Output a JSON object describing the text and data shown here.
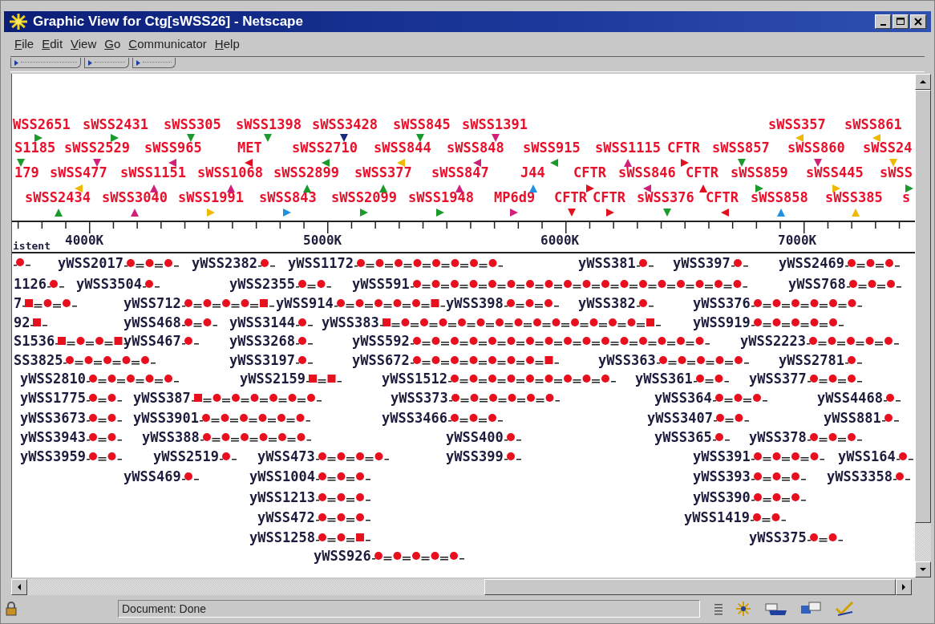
{
  "window": {
    "title": "Graphic View for Ctg[sWSS26] - Netscape"
  },
  "menu": [
    "File",
    "Edit",
    "View",
    "Go",
    "Communicator",
    "Help"
  ],
  "map": {
    "label_rows": [
      [
        "WSS2651",
        "sWSS2431",
        "sWSS305",
        "sWSS1398",
        "sWSS3428",
        "sWSS845",
        "sWSS1391",
        "sWSS357",
        "sWSS861"
      ],
      [
        "S1185",
        "sWSS2529",
        "sWSS965",
        "MET",
        "sWSS2710",
        "sWSS844",
        "sWSS848",
        "sWSS915",
        "sWSS1115",
        "CFTR",
        "sWSS857",
        "sWSS860",
        "sWSS24"
      ],
      [
        "179",
        "sWSS477",
        "sWSS1151",
        "sWSS1068",
        "sWSS2899",
        "sWSS377",
        "sWSS847",
        "J44",
        "CFTR",
        "sWSS846",
        "CFTR",
        "sWSS859",
        "sWSS445",
        "sWSS"
      ],
      [
        "sWSS2434",
        "sWSS3040",
        "sWSS1991",
        "sWSS843",
        "sWSS2099",
        "sWSS1948",
        "MP6d9",
        "CFTR",
        "CFTR",
        "sWSS376",
        "CFTR",
        "sWSS858",
        "sWSS385",
        "s"
      ]
    ],
    "triangle_rows": [
      [
        {
          "color": "#1a9a2a",
          "kind": "right"
        },
        {
          "color": "#1a9a2a",
          "kind": "right"
        },
        {
          "color": "#1a9a2a",
          "kind": "down"
        },
        {
          "color": "#1a9a2a",
          "kind": "down"
        },
        {
          "color": "#1a2a80",
          "kind": "down"
        },
        {
          "color": "#1a9a2a",
          "kind": "down"
        },
        {
          "color": "#d0207a",
          "kind": "down"
        },
        {
          "color": "#f0b800",
          "kind": "left"
        },
        {
          "color": "#f0b800",
          "kind": "left"
        }
      ],
      [
        {
          "color": "#1a9a2a",
          "kind": "down"
        },
        {
          "color": "#d0207a",
          "kind": "down"
        },
        {
          "color": "#d0207a",
          "kind": "left"
        },
        {
          "color": "#e01020",
          "kind": "left"
        },
        {
          "color": "#1a9a2a",
          "kind": "left"
        },
        {
          "color": "#f0b800",
          "kind": "left"
        },
        {
          "color": "#d0207a",
          "kind": "left"
        },
        {
          "color": "#1a9a2a",
          "kind": "left"
        },
        {
          "color": "#d0207a",
          "kind": "up"
        },
        {
          "color": "#e01020",
          "kind": "right"
        },
        {
          "color": "#1a9a2a",
          "kind": "down"
        },
        {
          "color": "#d0207a",
          "kind": "down"
        },
        {
          "color": "#f0b800",
          "kind": "down"
        }
      ],
      [
        {
          "color": "#f0b800",
          "kind": "left"
        },
        {
          "color": "#d0207a",
          "kind": "up"
        },
        {
          "color": "#d0207a",
          "kind": "up"
        },
        {
          "color": "#1a9a2a",
          "kind": "up"
        },
        {
          "color": "#1a9a2a",
          "kind": "up"
        },
        {
          "color": "#d0207a",
          "kind": "up"
        },
        {
          "color": "#2090e0",
          "kind": "up"
        },
        {
          "color": "#e01020",
          "kind": "right"
        },
        {
          "color": "#d0207a",
          "kind": "left"
        },
        {
          "color": "#e01020",
          "kind": "up"
        },
        {
          "color": "#1a9a2a",
          "kind": "right"
        },
        {
          "color": "#f0b800",
          "kind": "right"
        },
        {
          "color": "#1a9a2a",
          "kind": "right"
        }
      ],
      [
        {
          "color": "#1a9a2a",
          "kind": "up"
        },
        {
          "color": "#d0207a",
          "kind": "up"
        },
        {
          "color": "#f0b800",
          "kind": "right"
        },
        {
          "color": "#2090e0",
          "kind": "right"
        },
        {
          "color": "#1a9a2a",
          "kind": "right"
        },
        {
          "color": "#1a9a2a",
          "kind": "right"
        },
        {
          "color": "#d0207a",
          "kind": "right"
        },
        {
          "color": "#e01020",
          "kind": "down"
        },
        {
          "color": "#e01020",
          "kind": "right"
        },
        {
          "color": "#1a9a2a",
          "kind": "down"
        },
        {
          "color": "#e01020",
          "kind": "left"
        },
        {
          "color": "#2090e0",
          "kind": "up"
        },
        {
          "color": "#f0b800",
          "kind": "up"
        }
      ]
    ],
    "axis_labels": [
      "4000K",
      "5000K",
      "6000K",
      "7000K"
    ],
    "section_label": "istent",
    "contig_rows": [
      [
        {
          "marks": [
            {
              "kind": "dot"
            }
          ]
        },
        {
          "label": "yWSS2017",
          "marks": [
            {
              "kind": "dot"
            },
            {
              "kind": "dot"
            },
            {
              "kind": "dot"
            }
          ]
        },
        {
          "label": "yWSS2382",
          "marks": [
            {
              "kind": "dot"
            }
          ]
        },
        {
          "label": "yWSS1172",
          "marks": [
            {
              "kind": "dot"
            },
            {
              "kind": "dot"
            },
            {
              "kind": "dot"
            },
            {
              "kind": "dot"
            },
            {
              "kind": "dot"
            },
            {
              "kind": "dot"
            },
            {
              "kind": "dot"
            },
            {
              "kind": "dot"
            }
          ]
        },
        {
          "label": "yWSS381",
          "marks": [
            {
              "kind": "dot"
            }
          ]
        },
        {
          "label": "yWSS397",
          "marks": [
            {
              "kind": "dot"
            }
          ]
        },
        {
          "label": "yWSS2469",
          "marks": [
            {
              "kind": "dot"
            },
            {
              "kind": "dot"
            },
            {
              "kind": "dot"
            }
          ]
        }
      ],
      [
        {
          "label": "1126",
          "marks": [
            {
              "kind": "dot"
            }
          ]
        },
        {
          "label": "yWSS3504",
          "marks": [
            {
              "kind": "dot"
            }
          ]
        },
        {
          "label": "yWSS2355",
          "marks": [
            {
              "kind": "dot"
            },
            {
              "kind": "dot"
            }
          ]
        },
        {
          "label": "yWSS591",
          "marks": [
            {
              "kind": "dot"
            },
            {
              "kind": "dot"
            },
            {
              "kind": "dot"
            },
            {
              "kind": "dot"
            },
            {
              "kind": "dot"
            },
            {
              "kind": "dot"
            },
            {
              "kind": "dot"
            },
            {
              "kind": "dot"
            },
            {
              "kind": "dot"
            },
            {
              "kind": "dot"
            },
            {
              "kind": "dot"
            },
            {
              "kind": "dot"
            },
            {
              "kind": "dot"
            },
            {
              "kind": "dot"
            },
            {
              "kind": "dot"
            },
            {
              "kind": "dot"
            },
            {
              "kind": "dot"
            },
            {
              "kind": "dot"
            }
          ]
        },
        {
          "label": "yWSS768",
          "marks": [
            {
              "kind": "dot"
            },
            {
              "kind": "dot"
            },
            {
              "kind": "dot"
            }
          ]
        }
      ],
      [
        {
          "label": "7",
          "marks": [
            {
              "kind": "square"
            },
            {
              "kind": "dot"
            },
            {
              "kind": "dot"
            }
          ]
        },
        {
          "label": "yWSS712",
          "marks": [
            {
              "kind": "dot"
            },
            {
              "kind": "dot"
            },
            {
              "kind": "dot"
            },
            {
              "kind": "dot"
            },
            {
              "kind": "square"
            }
          ]
        },
        {
          "label": "yWSS914",
          "marks": [
            {
              "kind": "dot"
            },
            {
              "kind": "dot"
            },
            {
              "kind": "dot"
            },
            {
              "kind": "dot"
            },
            {
              "kind": "dot"
            },
            {
              "kind": "square"
            }
          ]
        },
        {
          "label": "yWSS398",
          "marks": [
            {
              "kind": "dot"
            },
            {
              "kind": "dot"
            },
            {
              "kind": "dot"
            }
          ]
        },
        {
          "label": "yWSS382",
          "marks": [
            {
              "kind": "dot"
            }
          ]
        },
        {
          "label": "yWSS376",
          "marks": [
            {
              "kind": "dot"
            },
            {
              "kind": "dot"
            },
            {
              "kind": "dot"
            },
            {
              "kind": "dot"
            },
            {
              "kind": "dot"
            },
            {
              "kind": "dot"
            }
          ]
        }
      ],
      [
        {
          "label": "92",
          "marks": [
            {
              "kind": "square"
            }
          ]
        },
        {
          "label": "yWSS468",
          "marks": [
            {
              "kind": "dot"
            },
            {
              "kind": "dot"
            }
          ]
        },
        {
          "label": "yWSS3144",
          "marks": [
            {
              "kind": "dot"
            }
          ]
        },
        {
          "label": "yWSS383",
          "marks": [
            {
              "kind": "square"
            },
            {
              "kind": "dot"
            },
            {
              "kind": "dot"
            },
            {
              "kind": "dot"
            },
            {
              "kind": "dot"
            },
            {
              "kind": "dot"
            },
            {
              "kind": "dot"
            },
            {
              "kind": "dot"
            },
            {
              "kind": "dot"
            },
            {
              "kind": "dot"
            },
            {
              "kind": "dot"
            },
            {
              "kind": "dot"
            },
            {
              "kind": "dot"
            },
            {
              "kind": "dot"
            },
            {
              "kind": "square"
            }
          ]
        },
        {
          "label": "yWSS919",
          "marks": [
            {
              "kind": "dot"
            },
            {
              "kind": "dot"
            },
            {
              "kind": "dot"
            },
            {
              "kind": "dot"
            },
            {
              "kind": "dot"
            }
          ]
        }
      ],
      [
        {
          "label": "S1536",
          "marks": [
            {
              "kind": "square"
            },
            {
              "kind": "dot"
            },
            {
              "kind": "dot"
            },
            {
              "kind": "square"
            }
          ]
        },
        {
          "label": "yWSS467",
          "marks": [
            {
              "kind": "dot"
            }
          ]
        },
        {
          "label": "yWSS3268",
          "marks": [
            {
              "kind": "dot"
            }
          ]
        },
        {
          "label": "yWSS592",
          "marks": [
            {
              "kind": "dot"
            },
            {
              "kind": "dot"
            },
            {
              "kind": "dot"
            },
            {
              "kind": "dot"
            },
            {
              "kind": "dot"
            },
            {
              "kind": "dot"
            },
            {
              "kind": "dot"
            },
            {
              "kind": "dot"
            },
            {
              "kind": "dot"
            },
            {
              "kind": "dot"
            },
            {
              "kind": "dot"
            },
            {
              "kind": "dot"
            },
            {
              "kind": "dot"
            },
            {
              "kind": "dot"
            },
            {
              "kind": "dot"
            },
            {
              "kind": "dot"
            }
          ]
        },
        {
          "label": "yWSS2223",
          "marks": [
            {
              "kind": "dot"
            },
            {
              "kind": "dot"
            },
            {
              "kind": "dot"
            },
            {
              "kind": "dot"
            },
            {
              "kind": "dot"
            }
          ]
        }
      ],
      [
        {
          "label": "SS3825",
          "marks": [
            {
              "kind": "dot"
            },
            {
              "kind": "dot"
            },
            {
              "kind": "dot"
            },
            {
              "kind": "dot"
            },
            {
              "kind": "dot"
            }
          ]
        },
        {
          "label": "yWSS3197",
          "marks": [
            {
              "kind": "dot"
            }
          ]
        },
        {
          "label": "yWSS672",
          "marks": [
            {
              "kind": "dot"
            },
            {
              "kind": "dot"
            },
            {
              "kind": "dot"
            },
            {
              "kind": "dot"
            },
            {
              "kind": "dot"
            },
            {
              "kind": "dot"
            },
            {
              "kind": "dot"
            },
            {
              "kind": "square"
            }
          ]
        },
        {
          "label": "yWSS363",
          "marks": [
            {
              "kind": "dot"
            },
            {
              "kind": "dot"
            },
            {
              "kind": "dot"
            },
            {
              "kind": "dot"
            },
            {
              "kind": "dot"
            }
          ]
        },
        {
          "label": "yWSS2781",
          "marks": [
            {
              "kind": "dot"
            }
          ]
        }
      ],
      [
        {
          "label": "yWSS2810",
          "marks": [
            {
              "kind": "dot"
            },
            {
              "kind": "dot"
            },
            {
              "kind": "dot"
            },
            {
              "kind": "dot"
            },
            {
              "kind": "dot"
            }
          ]
        },
        {
          "label": "yWSS2159",
          "marks": [
            {
              "kind": "square"
            },
            {
              "kind": "square"
            }
          ]
        },
        {
          "label": "yWSS1512",
          "marks": [
            {
              "kind": "dot"
            },
            {
              "kind": "dot"
            },
            {
              "kind": "dot"
            },
            {
              "kind": "dot"
            },
            {
              "kind": "dot"
            },
            {
              "kind": "dot"
            },
            {
              "kind": "dot"
            },
            {
              "kind": "dot"
            },
            {
              "kind": "dot"
            }
          ]
        },
        {
          "label": "yWSS361",
          "marks": [
            {
              "kind": "dot"
            },
            {
              "kind": "dot"
            }
          ]
        },
        {
          "label": "yWSS377",
          "marks": [
            {
              "kind": "dot"
            },
            {
              "kind": "dot"
            },
            {
              "kind": "dot"
            }
          ]
        }
      ],
      [
        {
          "label": "yWSS1775",
          "marks": [
            {
              "kind": "dot"
            },
            {
              "kind": "dot"
            }
          ]
        },
        {
          "label": "yWSS387",
          "marks": [
            {
              "kind": "square"
            },
            {
              "kind": "dot"
            },
            {
              "kind": "dot"
            },
            {
              "kind": "dot"
            },
            {
              "kind": "dot"
            },
            {
              "kind": "dot"
            },
            {
              "kind": "dot"
            }
          ]
        },
        {
          "label": "yWSS373",
          "marks": [
            {
              "kind": "dot"
            },
            {
              "kind": "dot"
            },
            {
              "kind": "dot"
            },
            {
              "kind": "dot"
            },
            {
              "kind": "dot"
            },
            {
              "kind": "dot"
            }
          ]
        },
        {
          "label": "yWSS364",
          "marks": [
            {
              "kind": "dot"
            },
            {
              "kind": "dot"
            },
            {
              "kind": "dot"
            }
          ]
        },
        {
          "label": "yWSS4468",
          "marks": [
            {
              "kind": "dot"
            }
          ]
        }
      ],
      [
        {
          "label": "yWSS3673",
          "marks": [
            {
              "kind": "dot"
            },
            {
              "kind": "dot"
            }
          ]
        },
        {
          "label": "yWSS3901",
          "marks": [
            {
              "kind": "dot"
            },
            {
              "kind": "dot"
            },
            {
              "kind": "dot"
            },
            {
              "kind": "dot"
            },
            {
              "kind": "dot"
            },
            {
              "kind": "dot"
            }
          ]
        },
        {
          "label": "yWSS3466",
          "marks": [
            {
              "kind": "dot"
            },
            {
              "kind": "dot"
            },
            {
              "kind": "dot"
            }
          ]
        },
        {
          "label": "yWSS3407",
          "marks": [
            {
              "kind": "dot"
            },
            {
              "kind": "dot"
            }
          ]
        },
        {
          "label": "yWSS881",
          "marks": [
            {
              "kind": "dot"
            }
          ]
        }
      ],
      [
        {
          "label": "yWSS3943",
          "marks": [
            {
              "kind": "dot"
            },
            {
              "kind": "dot"
            }
          ]
        },
        {
          "label": "yWSS388",
          "marks": [
            {
              "kind": "dot"
            },
            {
              "kind": "dot"
            },
            {
              "kind": "dot"
            },
            {
              "kind": "dot"
            },
            {
              "kind": "dot"
            },
            {
              "kind": "dot"
            }
          ]
        },
        {
          "label": "yWSS400",
          "marks": [
            {
              "kind": "dot"
            }
          ]
        },
        {
          "label": "yWSS365",
          "marks": [
            {
              "kind": "dot"
            }
          ]
        },
        {
          "label": "yWSS378",
          "marks": [
            {
              "kind": "dot"
            },
            {
              "kind": "dot"
            },
            {
              "kind": "dot"
            }
          ]
        }
      ],
      [
        {
          "label": "yWSS3959",
          "marks": [
            {
              "kind": "dot"
            },
            {
              "kind": "dot"
            }
          ]
        },
        {
          "label": "yWSS2519",
          "marks": [
            {
              "kind": "dot"
            }
          ]
        },
        {
          "label": "yWSS473",
          "marks": [
            {
              "kind": "dot"
            },
            {
              "kind": "dot"
            },
            {
              "kind": "dot"
            },
            {
              "kind": "dot"
            }
          ]
        },
        {
          "label": "yWSS399",
          "marks": [
            {
              "kind": "dot"
            }
          ]
        },
        {
          "label": "yWSS391",
          "marks": [
            {
              "kind": "dot"
            },
            {
              "kind": "dot"
            },
            {
              "kind": "dot"
            },
            {
              "kind": "dot"
            }
          ]
        },
        {
          "label": "yWSS164",
          "marks": [
            {
              "kind": "dot"
            }
          ]
        }
      ],
      [
        {
          "label": "yWSS469",
          "marks": [
            {
              "kind": "dot"
            }
          ]
        },
        {
          "label": "yWSS1004",
          "marks": [
            {
              "kind": "dot"
            },
            {
              "kind": "dot"
            },
            {
              "kind": "dot"
            }
          ]
        },
        {
          "label": "yWSS393",
          "marks": [
            {
              "kind": "dot"
            },
            {
              "kind": "dot"
            },
            {
              "kind": "dot"
            }
          ]
        },
        {
          "label": "yWSS3358",
          "marks": [
            {
              "kind": "dot"
            }
          ]
        }
      ],
      [
        {
          "label": "yWSS1213",
          "marks": [
            {
              "kind": "dot"
            },
            {
              "kind": "dot"
            },
            {
              "kind": "dot"
            }
          ]
        },
        {
          "label": "yWSS390",
          "marks": [
            {
              "kind": "dot"
            },
            {
              "kind": "dot"
            },
            {
              "kind": "dot"
            }
          ]
        }
      ],
      [
        {
          "label": "yWSS472",
          "marks": [
            {
              "kind": "dot"
            },
            {
              "kind": "dot"
            },
            {
              "kind": "dot"
            }
          ]
        },
        {
          "label": "yWSS1419",
          "marks": [
            {
              "kind": "dot"
            },
            {
              "kind": "dot"
            }
          ]
        }
      ],
      [
        {
          "label": "yWSS1258",
          "marks": [
            {
              "kind": "dot"
            },
            {
              "kind": "dot"
            },
            {
              "kind": "square"
            }
          ]
        },
        {
          "label": "yWSS375",
          "marks": [
            {
              "kind": "dot"
            },
            {
              "kind": "dot"
            }
          ]
        }
      ],
      [
        {
          "label": "yWSS926",
          "marks": [
            {
              "kind": "dot"
            },
            {
              "kind": "dot"
            },
            {
              "kind": "dot"
            },
            {
              "kind": "dot"
            },
            {
              "kind": "dot"
            }
          ]
        }
      ]
    ]
  },
  "status_bar": {
    "text": "Document: Done"
  }
}
